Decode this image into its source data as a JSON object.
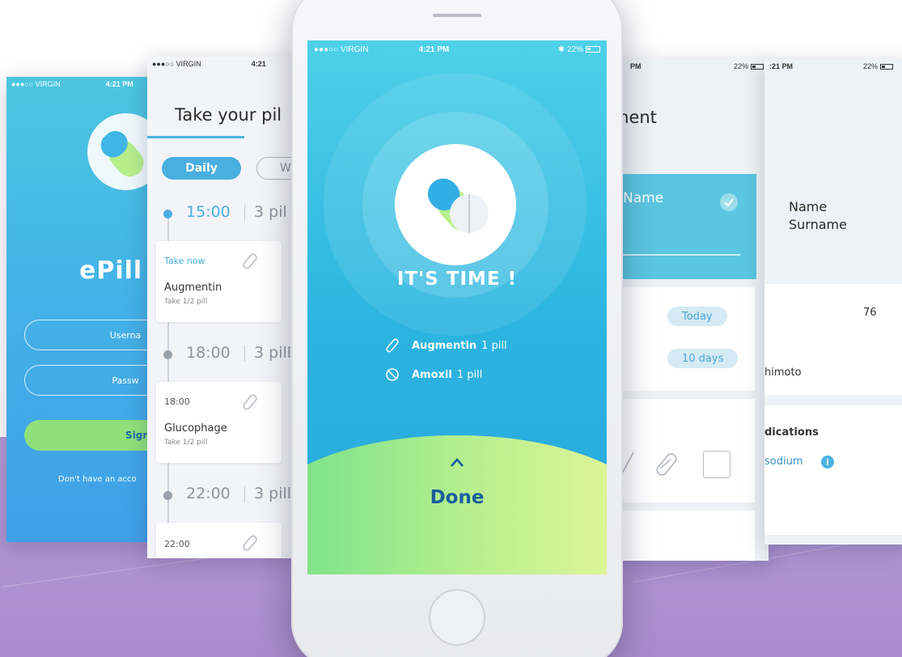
{
  "status_bar": {
    "carrier": "●●●○○ VIRGIN",
    "time": "4:21 PM",
    "battery": "22%",
    "time_partial_left": "4:21 PM",
    "time_partial_s2": "4:21",
    "time_partial_s3": "PM",
    "time_partial_s4": ":21 PM"
  },
  "login_screen": {
    "app_name": "ePill",
    "username_placeholder": "Userna",
    "password_placeholder": "Passw",
    "sign_in_label": "Sign",
    "footer_text": "Don't have an acco"
  },
  "schedule_screen": {
    "title": "Take your pil",
    "tabs": [
      {
        "label": "Daily",
        "active": true
      },
      {
        "label": "W",
        "active": false
      }
    ],
    "slots": [
      {
        "time": "15:00",
        "count": "3 pil",
        "card_head": "Take now",
        "name": "Augmentin",
        "sub": "Take 1/2 pill"
      },
      {
        "time": "18:00",
        "count": "3 pill",
        "card_head": "18:00",
        "name": "Glucophage",
        "sub": "Take 1/2 pill"
      },
      {
        "time": "22:00",
        "count": "3 pill",
        "card_head": "22:00",
        "name": "",
        "sub": ""
      }
    ]
  },
  "alert_screen": {
    "headline": "IT'S TIME !",
    "medications": [
      {
        "name": "Augmentin",
        "dose": "1 pill",
        "icon": "pill-icon"
      },
      {
        "name": "Amoxil",
        "dose": "1 pill",
        "icon": "ban-icon"
      }
    ],
    "done_label": "Done"
  },
  "treatment_screen": {
    "title": "ment",
    "name_label": "Name",
    "start_label": "Today",
    "duration_label": "10 days"
  },
  "profile_screen": {
    "name": "Name",
    "surname": "Surname",
    "number": "76",
    "last_name_fragment": "himoto",
    "medications_label": "dications",
    "medication_value": "sodium",
    "info_glyph": "i"
  },
  "colors": {
    "accent_blue": "#49aee0",
    "done_text": "#1c5e9c",
    "floor": "#b59bd6",
    "wave_green": "#6fe08a",
    "wave_yellow": "#e9f79a"
  }
}
